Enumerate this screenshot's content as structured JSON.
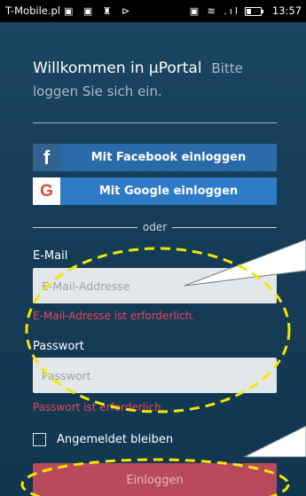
{
  "statusbar": {
    "carrier": "T-Mobile.pl",
    "left_icons": "▣ ▣ ♜ ⊳",
    "right_icons": "▣ ≋ .ıl",
    "time": "13:57"
  },
  "header": {
    "title": "Willkommen in µPortal",
    "subtitle": "Bitte loggen Sie sich ein."
  },
  "social": {
    "facebook_label": "Mit Facebook einloggen",
    "google_label": "Mit Google einloggen",
    "facebook_glyph": "f",
    "google_glyph": "G"
  },
  "divider": {
    "text": "oder"
  },
  "email": {
    "label": "E-Mail",
    "placeholder": "E-Mail-Addresse",
    "value": "",
    "error": "E-Mail-Adresse ist erforderlich."
  },
  "password": {
    "label": "Passwort",
    "placeholder": "Passwort",
    "value": "",
    "error": "Passwort ist erforderlich."
  },
  "remember": {
    "label": "Angemeldet bleiben",
    "checked": false
  },
  "login": {
    "label": "Einloggen"
  },
  "colors": {
    "background": "#173f5a",
    "facebook": "#2a6aa8",
    "google": "#2f7ac6",
    "error": "#e7465a",
    "login_button": "#b94a5c",
    "annotation": "#f2e600"
  }
}
